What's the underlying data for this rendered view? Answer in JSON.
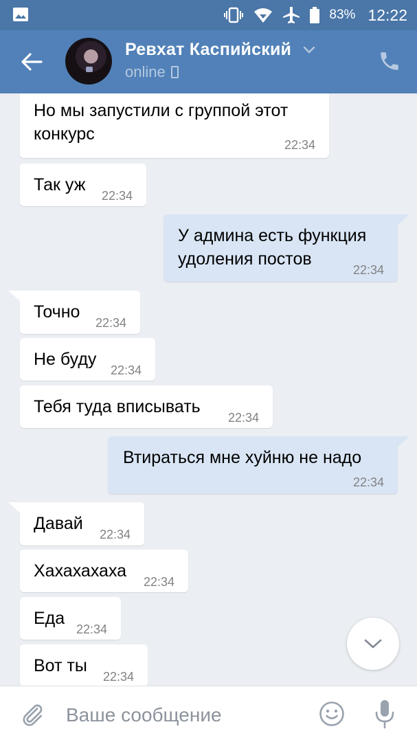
{
  "status_bar": {
    "battery_percent": "83%",
    "time": "12:22",
    "icons": [
      "gallery-icon",
      "vibrate-icon",
      "wifi-icon",
      "airplane-mode-icon",
      "battery-icon"
    ]
  },
  "header": {
    "contact_name": "Ревхат Каспийский",
    "status": "online",
    "icons": [
      "back-arrow-icon",
      "chevron-down-icon",
      "mobile-device-icon",
      "phone-icon"
    ]
  },
  "messages": [
    {
      "direction": "in",
      "lines": [
        "Но мы запустили с группой этот",
        "конкурс"
      ],
      "time": "22:34"
    },
    {
      "direction": "in",
      "lines": [
        "Так уж"
      ],
      "time": "22:34"
    },
    {
      "direction": "out",
      "lines": [
        "У админа есть функция",
        "удоления постов"
      ],
      "time": "22:34"
    },
    {
      "direction": "in",
      "lines": [
        "Точно"
      ],
      "time": "22:34"
    },
    {
      "direction": "in",
      "lines": [
        "Не буду"
      ],
      "time": "22:34"
    },
    {
      "direction": "in",
      "lines": [
        "Тебя туда вписывать"
      ],
      "time": "22:34"
    },
    {
      "direction": "out",
      "lines": [
        "Втираться мне хуйню не надо"
      ],
      "time": "22:34"
    },
    {
      "direction": "in",
      "lines": [
        "Давай"
      ],
      "time": "22:34"
    },
    {
      "direction": "in",
      "lines": [
        "Хахахахаха"
      ],
      "time": "22:34"
    },
    {
      "direction": "in",
      "lines": [
        "Еда"
      ],
      "time": "22:34"
    },
    {
      "direction": "in",
      "lines": [
        "Вот ты"
      ],
      "time": "22:34"
    }
  ],
  "composer": {
    "placeholder": "Ваше сообщение",
    "value": "",
    "icons": [
      "paperclip-icon",
      "emoji-icon",
      "microphone-icon"
    ]
  },
  "scroll_button": {
    "icon": "chevron-down-icon"
  },
  "colors": {
    "header_bg": "#5181b8",
    "status_bar_bg": "#4a76a8",
    "chat_bg": "#ebeef2",
    "incoming_bubble": "#ffffff",
    "outgoing_bubble": "#d9e5f5",
    "time_text": "#828282"
  }
}
